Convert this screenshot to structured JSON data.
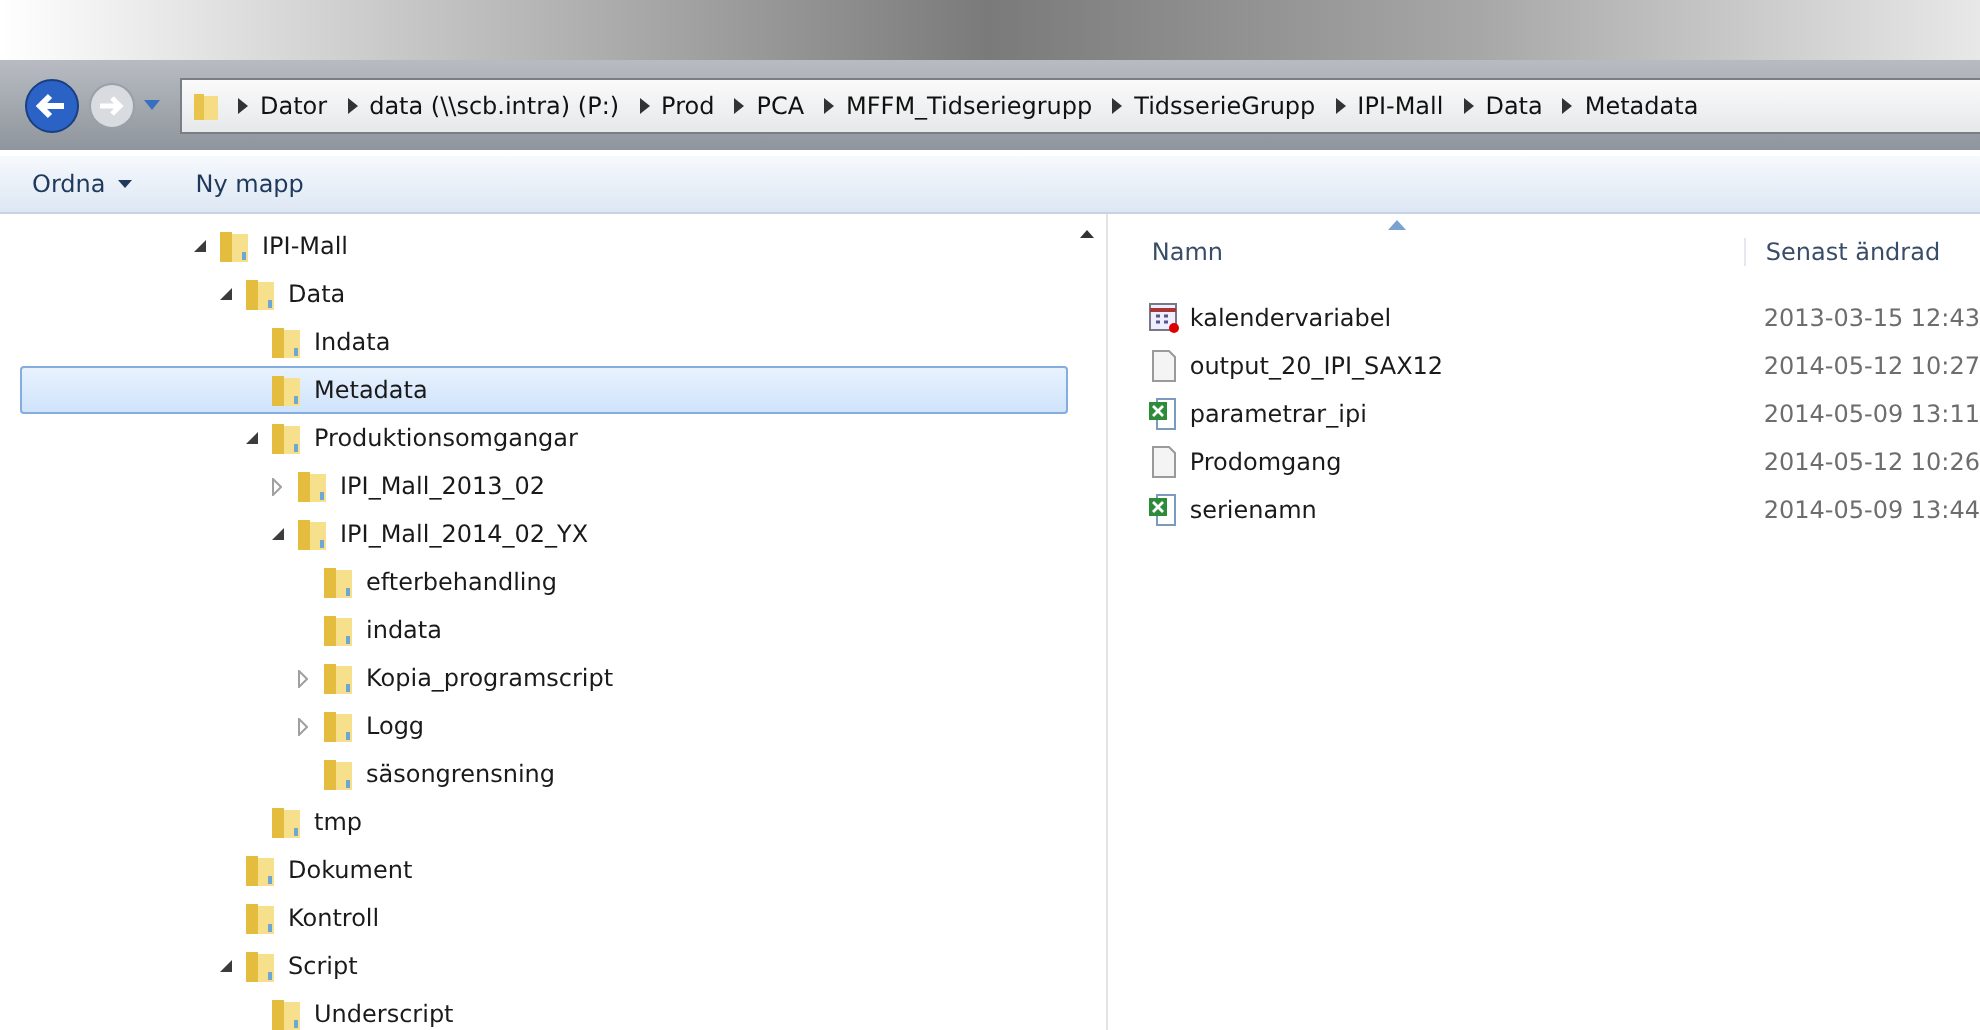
{
  "breadcrumb": [
    "Dator",
    "data (\\\\scb.intra) (P:)",
    "Prod",
    "PCA",
    "MFFM_Tidseriegrupp",
    "TidsserieGrupp",
    "IPI-Mall",
    "Data",
    "Metadata"
  ],
  "toolbar": [
    {
      "label": "Ordna",
      "dropdown": true
    },
    {
      "label": "Ny mapp",
      "dropdown": false
    }
  ],
  "tree": [
    {
      "label": "IPI-Mall",
      "expanded": true,
      "selected": false,
      "children": [
        {
          "label": "Data",
          "expanded": true,
          "selected": false,
          "children": [
            {
              "label": "Indata",
              "selected": false
            },
            {
              "label": "Metadata",
              "selected": true
            },
            {
              "label": "Produktionsomgangar",
              "expanded": true,
              "selected": false,
              "children": [
                {
                  "label": "IPI_Mall_2013_02",
                  "expanded": false,
                  "selected": false
                },
                {
                  "label": "IPI_Mall_2014_02_YX",
                  "expanded": true,
                  "selected": false,
                  "children": [
                    {
                      "label": "efterbehandling",
                      "selected": false
                    },
                    {
                      "label": "indata",
                      "selected": false
                    },
                    {
                      "label": "Kopia_programscript",
                      "expanded": false,
                      "selected": false
                    },
                    {
                      "label": "Logg",
                      "expanded": false,
                      "selected": false
                    },
                    {
                      "label": "säsongrensning",
                      "selected": false
                    }
                  ]
                }
              ]
            },
            {
              "label": "tmp",
              "selected": false
            }
          ]
        },
        {
          "label": "Dokument",
          "selected": false
        },
        {
          "label": "Kontroll",
          "selected": false
        },
        {
          "label": "Script",
          "expanded": true,
          "selected": false,
          "children": [
            {
              "label": "Underscript",
              "selected": false
            }
          ]
        }
      ]
    }
  ],
  "columns": [
    "Namn",
    "Senast ändrad"
  ],
  "files": [
    {
      "name": "kalendervariabel",
      "kind": "calendar",
      "modified": "2013-03-15 12:43"
    },
    {
      "name": "output_20_IPI_SAX12",
      "kind": "text",
      "modified": "2014-05-12 10:27"
    },
    {
      "name": "parametrar_ipi",
      "kind": "excel",
      "modified": "2014-05-09 13:11"
    },
    {
      "name": "Prodomgang",
      "kind": "text",
      "modified": "2014-05-12 10:26"
    },
    {
      "name": "serienamn",
      "kind": "excel",
      "modified": "2014-05-09 13:44"
    }
  ]
}
